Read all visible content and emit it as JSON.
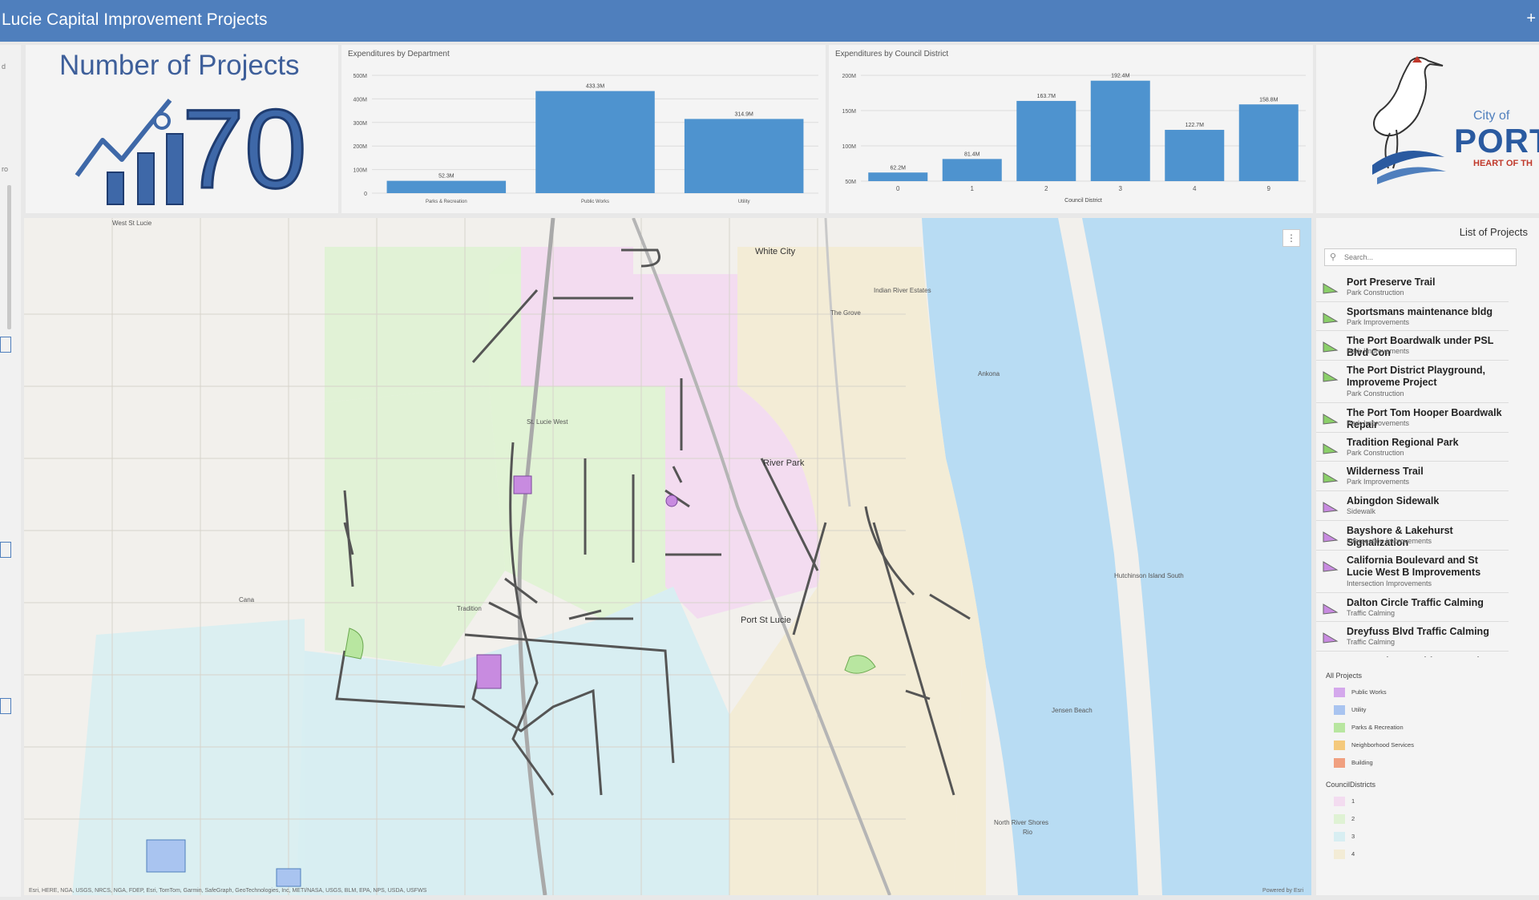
{
  "header": {
    "title": "Lucie Capital Improvement Projects",
    "plus": "+"
  },
  "count_card": {
    "title": "Number of Projects",
    "value": "70"
  },
  "dept_chart": {
    "title": "Expenditures by Department",
    "chart_data": {
      "type": "bar",
      "categories": [
        "Parks & Recreation",
        "Public Works",
        "Utility"
      ],
      "values": [
        52.3,
        433.3,
        314.9
      ],
      "value_labels": [
        "52.3M",
        "433.3M",
        "314.9M"
      ],
      "yticks": [
        "0",
        "100M",
        "200M",
        "300M",
        "400M",
        "500M"
      ],
      "ylim": [
        0,
        500
      ],
      "color": "#4e93cf"
    }
  },
  "district_chart": {
    "title": "Expenditures by Council District",
    "chart_data": {
      "type": "bar",
      "categories": [
        "0",
        "1",
        "2",
        "3",
        "4",
        "9"
      ],
      "values": [
        62.2,
        81.4,
        163.7,
        192.4,
        122.7,
        158.8
      ],
      "value_labels": [
        "62.2M",
        "81.4M",
        "163.7M",
        "192.4M",
        "122.7M",
        "158.8M"
      ],
      "yticks": [
        "50M",
        "100M",
        "150M",
        "200M"
      ],
      "ylim": [
        50,
        200
      ],
      "xlabel": "Council District",
      "color": "#4e93cf"
    }
  },
  "logo": {
    "city": "City of",
    "port": "PORT ST",
    "heart": "HEART OF TH"
  },
  "project_list": {
    "title": "List of Projects",
    "search_placeholder": "Search...",
    "items": [
      {
        "name": "Port Preserve Trail",
        "category": "Park Construction",
        "color": "#8bcf6a"
      },
      {
        "name": "Sportsmans maintenance bldg",
        "category": "Park Improvements",
        "color": "#8bcf6a"
      },
      {
        "name": "The Port Boardwalk under PSL Blvd Con",
        "category": "Park Improvements",
        "color": "#8bcf6a"
      },
      {
        "name": "The Port District Playground, Improveme Project",
        "category": "Park Construction",
        "color": "#8bcf6a",
        "tall": true
      },
      {
        "name": "The Port Tom Hooper Boardwalk Repair",
        "category": "Park Improvements",
        "color": "#8bcf6a"
      },
      {
        "name": "Tradition Regional Park",
        "category": "Park Construction",
        "color": "#8bcf6a"
      },
      {
        "name": "Wilderness Trail",
        "category": "Park Improvements",
        "color": "#8bcf6a"
      },
      {
        "name": "Abingdon Sidewalk",
        "category": "Sidewalk",
        "color": "#c88be0"
      },
      {
        "name": "Bayshore & Lakehurst Signalization",
        "category": "Intersection Improvements",
        "color": "#c88be0"
      },
      {
        "name": "California Boulevard and St Lucie West B Improvements",
        "category": "Intersection Improvements",
        "color": "#c88be0",
        "tall": true
      },
      {
        "name": "Dalton Circle Traffic Calming",
        "category": "Traffic Calming",
        "color": "#c88be0"
      },
      {
        "name": "Dreyfuss Blvd Traffic Calming",
        "category": "Traffic Calming",
        "color": "#c88be0"
      },
      {
        "name": "East Torino at Midway Road Lane Improv",
        "category": "",
        "color": "#c88be0"
      }
    ]
  },
  "legend": {
    "all_projects_title": "All Projects",
    "all_projects": [
      {
        "label": "Public Works",
        "color": "#d4a8ec"
      },
      {
        "label": "Utility",
        "color": "#a9c4f0"
      },
      {
        "label": "Parks & Recreation",
        "color": "#b8e6a0"
      },
      {
        "label": "Neighborhood Services",
        "color": "#f4c97c"
      },
      {
        "label": "Building",
        "color": "#f0a080"
      }
    ],
    "districts_title": "CouncilDistricts",
    "districts": [
      {
        "label": "1",
        "color": "#f3dcf0"
      },
      {
        "label": "2",
        "color": "#dff2d4"
      },
      {
        "label": "3",
        "color": "#d8eef2"
      },
      {
        "label": "4",
        "color": "#f3ecd6"
      }
    ]
  },
  "map": {
    "labels": {
      "white_city": "White City",
      "river_park": "River Park",
      "port_st_lucie": "Port St Lucie",
      "ankona": "Ankona",
      "jensen_beach": "Jensen Beach",
      "rio": "Rio",
      "cana": "Cana",
      "indian_river_estates": "Indian River Estates",
      "the_grove": "The Grove",
      "hutchinson_island": "Hutchinson Island South",
      "north_river_shores": "North River Shores",
      "tradition": "Tradition",
      "st_lucie_west": "St. Lucie West",
      "west_st_lucie": "West St Lucie"
    },
    "attribution_left": "Esri, HERE, NGA, USGS, NRCS, NGA, FDEP, Esri, TomTom, Garmin, SafeGraph, GeoTechnologies, Inc, METI/NASA, USGS, BLM, EPA, NPS, USDA, USFWS",
    "attribution_right": "Powered by Esri"
  },
  "left_strip": {
    "tick_a": "d",
    "tick_b": "ro"
  }
}
